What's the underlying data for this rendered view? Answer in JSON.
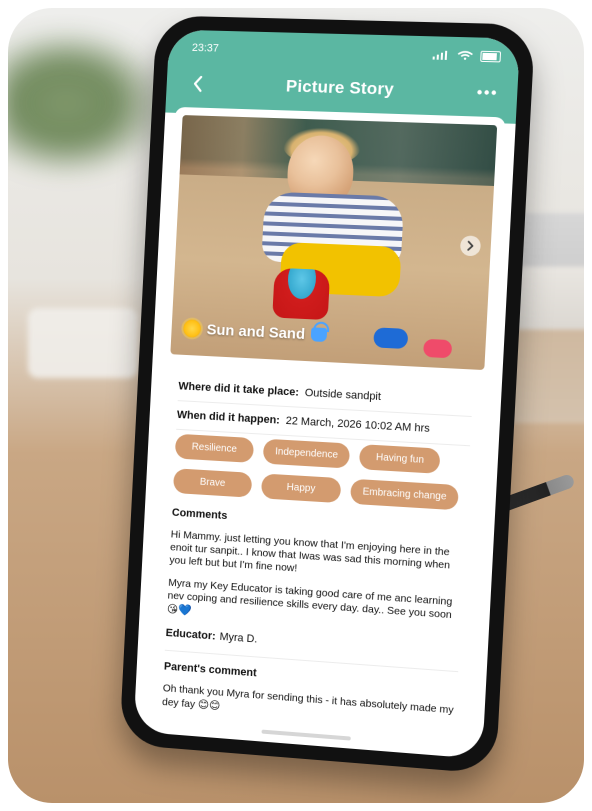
{
  "colors": {
    "header_teal": "#5bb7a2",
    "tag_tan": "#d39b6f"
  },
  "status_bar": {
    "time": "23:37",
    "icons": [
      "signal-icon",
      "wifi-icon",
      "battery-icon"
    ]
  },
  "header": {
    "title": "Picture Story",
    "left_icon": "back-icon",
    "right_icon": "more-icon"
  },
  "hero": {
    "caption": "Sun and Sand",
    "caption_icons": [
      "sun-icon",
      "bucket-icon"
    ],
    "next_icon": "chevron-right-icon"
  },
  "details": {
    "where_label": "Where did it take place:",
    "where_value": "Outside sandpit",
    "when_label": "When did it happen:",
    "when_value": "22 March, 2026 10:02 AM hrs"
  },
  "tags": [
    "Resilience",
    "Independence",
    "Having fun",
    "Brave",
    "Happy",
    "Embracing change"
  ],
  "comments": {
    "title": "Comments",
    "paragraph_1": "Hi Mammy. just letting you know that I'm enjoying here in the enoit tur sanpit.. I know that Iwas was sad this morning when you left but but I'm fine now!",
    "paragraph_2": "Myra my Key Educator is taking good care of me anc learning nev coping and resilience skills every day. day.. See you soon",
    "paragraph_2_emojis": "😘💙",
    "educator_label": "Educator:",
    "educator_value": "Myra D.",
    "parent_title": "Parent's comment",
    "parent_text": "Oh thank you Myra for sending this - it has absolutely made my dey fay",
    "parent_emojis": "😊😊"
  }
}
